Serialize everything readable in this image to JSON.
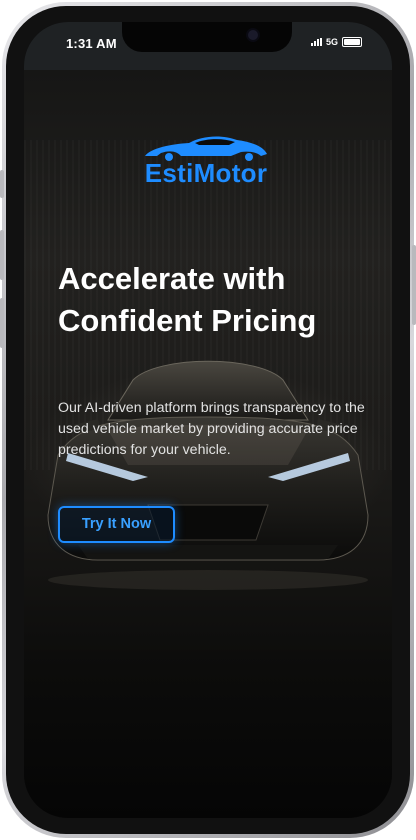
{
  "status_bar": {
    "time": "1:31 AM",
    "network": "5G",
    "signal_icon": "signal-bars-icon",
    "battery_icon": "battery-icon"
  },
  "brand": {
    "name": "EstiMotor",
    "logo_icon": "sports-car-icon",
    "color": "#1e8cff"
  },
  "hero": {
    "headline": "Accelerate with Confident Pricing",
    "description": "Our AI-driven platform brings transparency to the used vehicle market by providing accurate price predictions for your vehicle.",
    "cta_label": "Try It Now"
  },
  "colors": {
    "accent": "#1e8cff",
    "background": "#0b0b0b",
    "status_bar": "#1f2224"
  }
}
